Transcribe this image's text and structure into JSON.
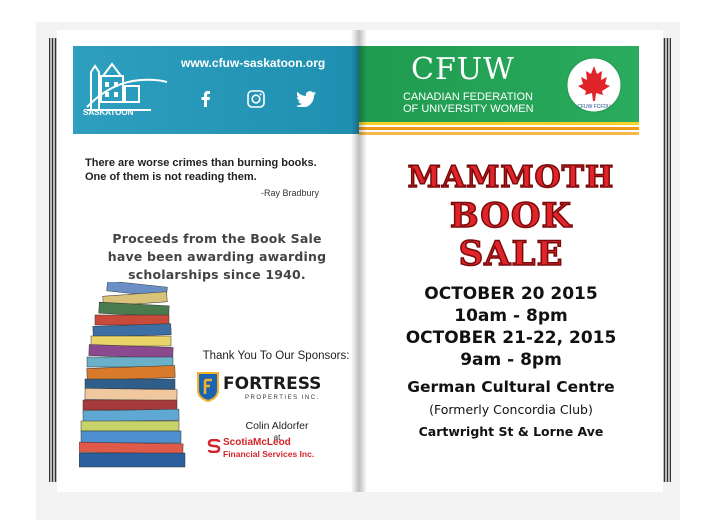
{
  "left_page": {
    "logo_text": "SASKATOON",
    "url": "www.cfuw-saskatoon.org",
    "social_icons": [
      "facebook-icon",
      "instagram-icon",
      "twitter-icon"
    ],
    "quote_line1": "There are worse crimes than burning books.",
    "quote_line2": "One of them is not reading them.",
    "quote_author": "-Ray Bradbury",
    "proceeds_line1": "Proceeds from the Book Sale",
    "proceeds_line2": "have been awarding awarding",
    "proceeds_line3": "scholarships since 1940.",
    "sponsors_heading": "Thank You To Our Sponsors:",
    "fortress_name": "FORTRESS",
    "fortress_sub": "PROPERTIES INC.",
    "colin_name": "Colin Aldorfer",
    "colin_at": "at",
    "scotia_line1": "ScotiaMcLeod",
    "scotia_line2": "Financial Services Inc."
  },
  "right_page": {
    "brand": "CFUW",
    "brand_sub1": "CANADIAN FEDERATION",
    "brand_sub2": "OF UNIVERSITY WOMEN",
    "emblem_text": "CFUW FCFDU",
    "title1": "MAMMOTH",
    "title2": "BOOK",
    "title3": "SALE",
    "date1": "OCTOBER 20 2015",
    "time1": "10am - 8pm",
    "date2": "OCTOBER 21-22, 2015",
    "time2": "9am - 8pm",
    "venue": "German Cultural Centre",
    "venue_former": "(Formerly Concordia Club)",
    "address": "Cartwright St & Lorne Ave"
  },
  "colors": {
    "teal": "#2f9fbf",
    "green": "#1f9b4f",
    "title_red": "#e0242a",
    "stripe_orange": "#f39a1e",
    "stripe_yellow": "#f5d12a"
  }
}
